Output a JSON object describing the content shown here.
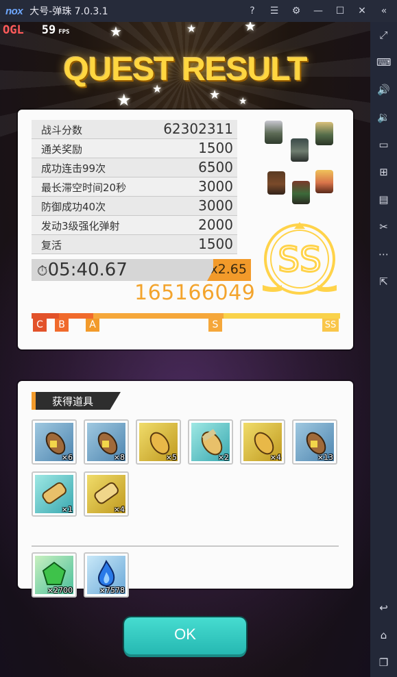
{
  "window": {
    "logo": "nox",
    "title": "大号-弹珠 7.0.3.1",
    "controls": [
      "help-icon",
      "menu-icon",
      "settings-icon",
      "minimize-icon",
      "maximize-icon",
      "close-icon",
      "collapse-icon"
    ]
  },
  "overlay": {
    "ogl": "OGL",
    "fps_value": "59",
    "fps_label": "FPS"
  },
  "quest": {
    "title": "QUEST RESULT",
    "score_rows": [
      {
        "label": "战斗分数",
        "value": "62302311"
      },
      {
        "label": "通关奖励",
        "value": "1500"
      },
      {
        "label": "成功连击99次",
        "value": "6500"
      },
      {
        "label": "最长滞空时间20秒",
        "value": "3000"
      },
      {
        "label": "防御成功40次",
        "value": "3000"
      },
      {
        "label": "发动3级强化弹射",
        "value": "2000"
      },
      {
        "label": "复活",
        "value": "1500"
      }
    ],
    "clear_time": "05:40.67",
    "multiplier": "x2.65",
    "total_score": "165166049",
    "rank": "SS",
    "gauge_labels": [
      "C",
      "B",
      "A",
      "S",
      "SS"
    ],
    "gauge_fill_fraction": 1.0
  },
  "items_section": {
    "title": "获得道具",
    "items": [
      {
        "icon": "brown-potion-blue-bg-icon",
        "count": "×6"
      },
      {
        "icon": "brown-potion-blue-bg-icon",
        "count": "×8"
      },
      {
        "icon": "gold-potion-yellow-bg-icon",
        "count": "×5"
      },
      {
        "icon": "scroll-potion-cyan-bg-icon",
        "count": "×2"
      },
      {
        "icon": "gold-potion-yellow-bg-icon",
        "count": "×4"
      },
      {
        "icon": "brown-potion-blue-bg-icon",
        "count": "×13"
      },
      {
        "icon": "scroll-cyan-bg-icon",
        "count": "×1"
      },
      {
        "icon": "scroll-yellow-bg-icon",
        "count": "×4"
      }
    ],
    "currency": [
      {
        "icon": "green-gem-icon",
        "count": "×2700"
      },
      {
        "icon": "blue-flame-icon",
        "count": "×7578"
      }
    ]
  },
  "ok_button": "OK",
  "colors": {
    "accent_orange": "#f29a2a",
    "score_gold": "#f3a42d",
    "rank_gold": "#ffd34a",
    "ok_teal": "#2fc8c0"
  },
  "sidebar_icons": [
    "fullscreen-icon",
    "keyboard-icon",
    "volume-up-icon",
    "volume-down-icon",
    "screen-icon",
    "apk-install-icon",
    "multi-window-icon",
    "scissors-icon",
    "more-icon",
    "open-external-icon",
    "back-icon",
    "home-icon",
    "recent-apps-icon"
  ]
}
